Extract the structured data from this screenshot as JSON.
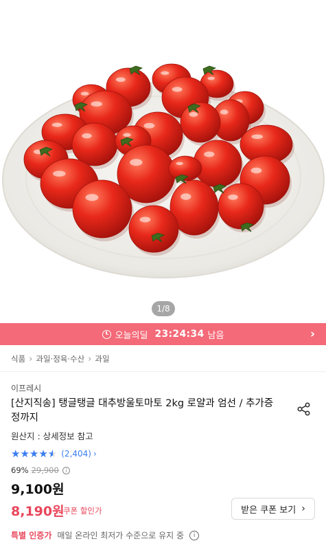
{
  "gallery": {
    "counter": "1/8"
  },
  "deal": {
    "label": "오늘의딜",
    "time_left": "23:24:34",
    "suffix": "남음"
  },
  "breadcrumb": [
    "식품",
    "과일·정육·수산",
    "과일"
  ],
  "product": {
    "seller": "이프레시",
    "title": "[산지직송] 탱글탱글 대추방울토마토 2kg 로얄과 엄선 / 추가증정까지",
    "origin": "원산지 : 상세정보 참고",
    "rating": 4.5,
    "review_count": "(2,404)",
    "discount_rate": "69%",
    "original_price": "29,900",
    "price": "9,100원",
    "coupon_price": "8,190원",
    "coupon_label": "쿠폰 할인가",
    "coupon_button": "받은 쿠폰 보기",
    "cert_label": "특별 인증가",
    "cert_text": "매일 온라인 최저가 수준으로 유지 중"
  },
  "colors": {
    "deal_bar": "#f46a78",
    "accent_red": "#e8465b",
    "star_blue": "#3a7df2"
  }
}
